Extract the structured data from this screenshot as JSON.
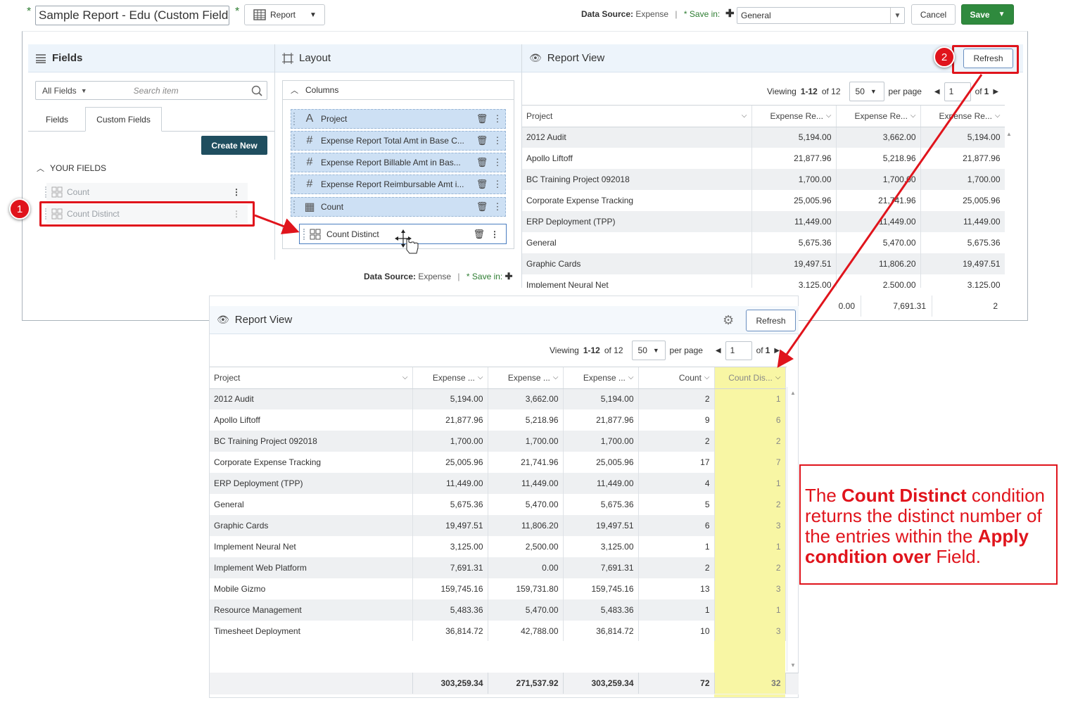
{
  "header": {
    "report_title": "Sample Report - Edu (Custom Fields",
    "report_type": "Report",
    "data_source_label": "Data Source:",
    "data_source_value": "Expense",
    "save_in_label": "* Save in:",
    "save_in_value": "General",
    "cancel_label": "Cancel",
    "save_label": "Save"
  },
  "fields_panel": {
    "title": "Fields",
    "filter_value": "All Fields",
    "search_placeholder": "Search item",
    "tabs": [
      "Fields",
      "Custom Fields"
    ],
    "active_tab": "Custom Fields",
    "create_new_label": "Create New",
    "section_label": "YOUR FIELDS",
    "items": [
      "Count",
      "Count Distinct"
    ]
  },
  "layout_panel": {
    "title": "Layout",
    "section_label": "Columns",
    "columns": [
      {
        "icon": "text-icon",
        "label": "Project"
      },
      {
        "icon": "hash-icon",
        "label": "Expense Report Total Amt in Base C..."
      },
      {
        "icon": "hash-icon",
        "label": "Expense Report Billable Amt in Bas..."
      },
      {
        "icon": "hash-icon",
        "label": "Expense Report Reimbursable Amt i..."
      },
      {
        "icon": "grid-icon",
        "label": "Count"
      }
    ],
    "dragging": {
      "icon": "grid-icon",
      "label": "Count Distinct"
    },
    "footer_data_source_label": "Data Source:",
    "footer_data_source_value": "Expense",
    "footer_save_in_label": "* Save in:"
  },
  "report_view_top": {
    "title": "Report View",
    "refresh_label": "Refresh",
    "viewing_prefix": "Viewing",
    "viewing_range": "1-12",
    "viewing_of": "of 12",
    "per_page_value": "50",
    "per_page_label": "per page",
    "page_value": "1",
    "page_of_prefix": "of",
    "page_of_total": "1",
    "headers": [
      "Project",
      "Expense Re...",
      "Expense Re...",
      "Expense Re..."
    ],
    "rows": [
      [
        "2012 Audit",
        "5,194.00",
        "3,662.00",
        "5,194.00"
      ],
      [
        "Apollo Liftoff",
        "21,877.96",
        "5,218.96",
        "21,877.96"
      ],
      [
        "BC Training Project 092018",
        "1,700.00",
        "1,700.00",
        "1,700.00"
      ],
      [
        "Corporate Expense Tracking",
        "25,005.96",
        "21,741.96",
        "25,005.96"
      ],
      [
        "ERP Deployment (TPP)",
        "11,449.00",
        "11,449.00",
        "11,449.00"
      ],
      [
        "General",
        "5,675.36",
        "5,470.00",
        "5,675.36"
      ],
      [
        "Graphic Cards",
        "19,497.51",
        "11,806.20",
        "19,497.51"
      ],
      [
        "Implement Neural Net",
        "3,125.00",
        "2,500.00",
        "3,125.00"
      ]
    ],
    "partial_row": [
      "0.00",
      "7,691.31",
      "2"
    ]
  },
  "report_view_bottom": {
    "title": "Report View",
    "refresh_label": "Refresh",
    "viewing_prefix": "Viewing",
    "viewing_range": "1-12",
    "viewing_of": "of 12",
    "per_page_value": "50",
    "per_page_label": "per page",
    "page_value": "1",
    "page_of_prefix": "of",
    "page_of_total": "1",
    "headers": [
      "Project",
      "Expense ...",
      "Expense ...",
      "Expense ...",
      "Count",
      "Count Dis..."
    ],
    "rows": [
      [
        "2012 Audit",
        "5,194.00",
        "3,662.00",
        "5,194.00",
        "2",
        "1"
      ],
      [
        "Apollo Liftoff",
        "21,877.96",
        "5,218.96",
        "21,877.96",
        "9",
        "6"
      ],
      [
        "BC Training Project 092018",
        "1,700.00",
        "1,700.00",
        "1,700.00",
        "2",
        "2"
      ],
      [
        "Corporate Expense Tracking",
        "25,005.96",
        "21,741.96",
        "25,005.96",
        "17",
        "7"
      ],
      [
        "ERP Deployment (TPP)",
        "11,449.00",
        "11,449.00",
        "11,449.00",
        "4",
        "1"
      ],
      [
        "General",
        "5,675.36",
        "5,470.00",
        "5,675.36",
        "5",
        "2"
      ],
      [
        "Graphic Cards",
        "19,497.51",
        "11,806.20",
        "19,497.51",
        "6",
        "3"
      ],
      [
        "Implement Neural Net",
        "3,125.00",
        "2,500.00",
        "3,125.00",
        "1",
        "1"
      ],
      [
        "Implement Web Platform",
        "7,691.31",
        "0.00",
        "7,691.31",
        "2",
        "2"
      ],
      [
        "Mobile Gizmo",
        "159,745.16",
        "159,731.80",
        "159,745.16",
        "13",
        "3"
      ],
      [
        "Resource Management",
        "5,483.36",
        "5,470.00",
        "5,483.36",
        "1",
        "1"
      ],
      [
        "Timesheet Deployment",
        "36,814.72",
        "42,788.00",
        "36,814.72",
        "10",
        "3"
      ]
    ],
    "totals": [
      "",
      "303,259.34",
      "271,537.92",
      "303,259.34",
      "72",
      "32"
    ]
  },
  "annotations": {
    "step1": "1",
    "step2": "2",
    "callout_bold1": "Count Distinct",
    "callout_text1": " condition returns the distinct number of the entries within the ",
    "callout_bold2": "Apply condition over",
    "callout_text2": " Field."
  },
  "colors": {
    "accent_red": "#e0141c",
    "save_green": "#2f8a3e",
    "highlight_yellow": "#f8f6a4",
    "create_new": "#1f4e5f"
  }
}
